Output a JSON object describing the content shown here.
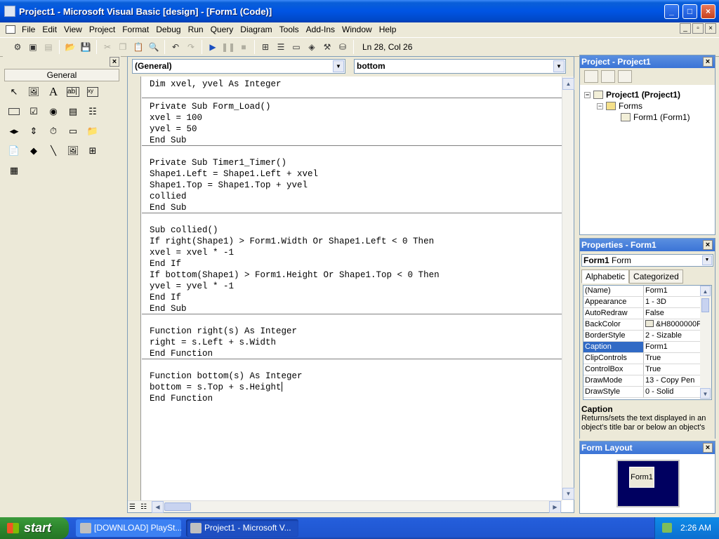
{
  "window": {
    "title": "Project1 - Microsoft Visual Basic [design] - [Form1 (Code)]",
    "controls": [
      "_",
      "□",
      "×"
    ]
  },
  "menu": [
    "File",
    "Edit",
    "View",
    "Project",
    "Format",
    "Debug",
    "Run",
    "Query",
    "Diagram",
    "Tools",
    "Add-Ins",
    "Window",
    "Help"
  ],
  "toolbar": {
    "position": "Ln 28, Col 26"
  },
  "toolbox": {
    "tab_label": "General",
    "close_label": "×"
  },
  "code": {
    "object_combo": "(General)",
    "procedure_combo": "bottom",
    "lines": [
      "Dim xvel, yvel As Integer",
      "Private Sub Form_Load()",
      "xvel = 100",
      "yvel = 50",
      "End Sub",
      "Private Sub Timer1_Timer()",
      "Shape1.Left = Shape1.Left + xvel",
      "Shape1.Top = Shape1.Top + yvel",
      "collied",
      "End Sub",
      "Sub collied()",
      "If right(Shape1) > Form1.Width Or Shape1.Left < 0 Then",
      "xvel = xvel * -1",
      "End If",
      "If bottom(Shape1) > Form1.Height Or Shape1.Top < 0 Then",
      "yvel = yvel * -1",
      "End If",
      "End Sub",
      "Function right(s) As Integer",
      "right = s.Left + s.Width",
      "End Function",
      "Function bottom(s) As Integer",
      "bottom = s.Top + s.Height",
      "End Function"
    ]
  },
  "project": {
    "title": "Project - Project1",
    "root": "Project1 (Project1)",
    "folder": "Forms",
    "item": "Form1 (Form1)"
  },
  "properties": {
    "title": "Properties - Form1",
    "object_name": "Form1",
    "object_type": "Form",
    "tabs": [
      "Alphabetic",
      "Categorized"
    ],
    "rows": [
      {
        "name": "(Name)",
        "value": "Form1"
      },
      {
        "name": "Appearance",
        "value": "1 - 3D"
      },
      {
        "name": "AutoRedraw",
        "value": "False"
      },
      {
        "name": "BackColor",
        "value": "&H8000000F"
      },
      {
        "name": "BorderStyle",
        "value": "2 - Sizable"
      },
      {
        "name": "Caption",
        "value": "Form1"
      },
      {
        "name": "ClipControls",
        "value": "True"
      },
      {
        "name": "ControlBox",
        "value": "True"
      },
      {
        "name": "DrawMode",
        "value": "13 - Copy Pen"
      },
      {
        "name": "DrawStyle",
        "value": "0 - Solid"
      }
    ],
    "selected_row": "Caption",
    "desc_title": "Caption",
    "desc_text": "Returns/sets the text displayed in an object's title bar or below an object's"
  },
  "form_layout": {
    "title": "Form Layout",
    "form_label": "Form1"
  },
  "taskbar": {
    "start": "start",
    "tasks": [
      "[DOWNLOAD] PlaySt...",
      "Project1 - Microsoft V..."
    ],
    "clock": "2:26 AM"
  }
}
